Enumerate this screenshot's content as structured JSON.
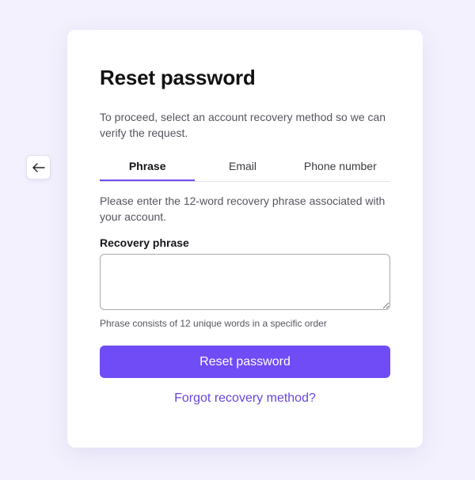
{
  "back_button": {
    "icon": "arrow-left-icon"
  },
  "card": {
    "title": "Reset password",
    "intro": "To proceed, select an account recovery method so we can verify the request.",
    "tabs": [
      {
        "label": "Phrase",
        "active": true
      },
      {
        "label": "Email",
        "active": false
      },
      {
        "label": "Phone number",
        "active": false
      }
    ],
    "tab_description": "Please enter the 12-word recovery phrase associated with your account.",
    "field": {
      "label": "Recovery phrase",
      "value": "",
      "placeholder": ""
    },
    "hint": "Phrase consists of 12 unique words in a specific order",
    "submit_label": "Reset password",
    "forgot_label": "Forgot recovery method?"
  },
  "colors": {
    "accent": "#6f4cf6",
    "link": "#6a45e0",
    "background": "#f3f1fd",
    "card": "#ffffff"
  }
}
